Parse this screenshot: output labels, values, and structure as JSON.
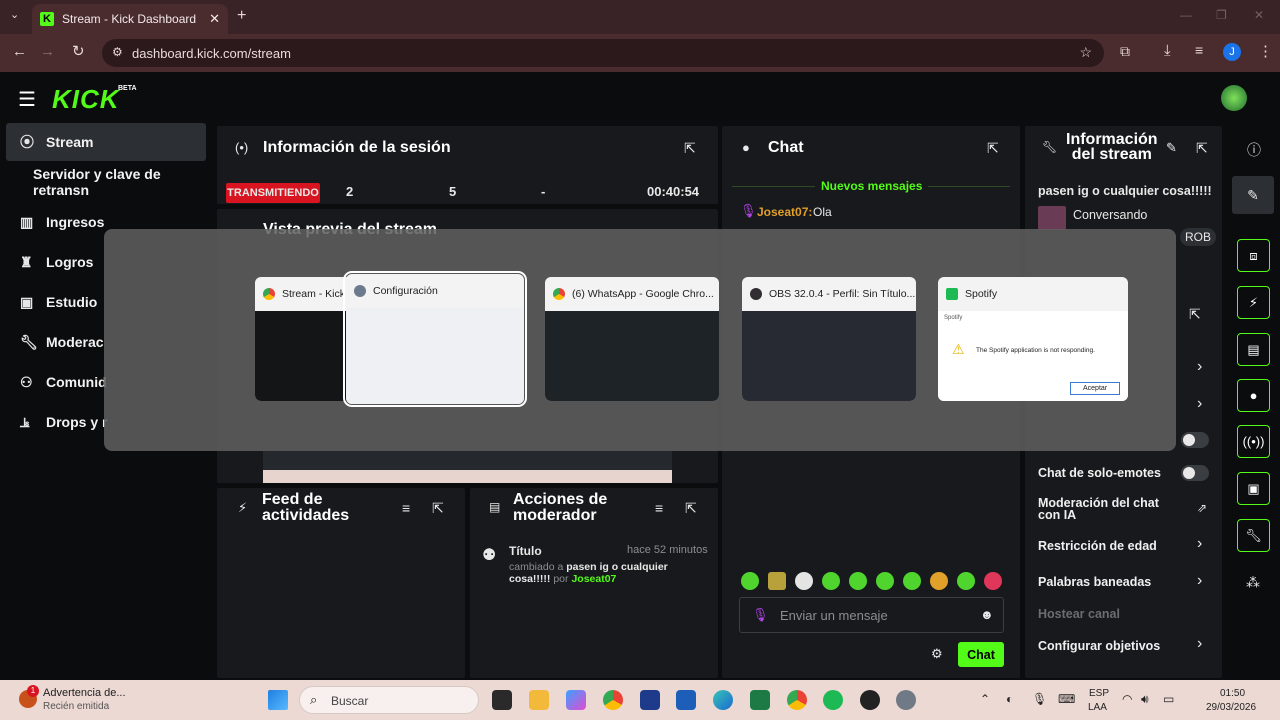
{
  "browser": {
    "tab_title": "Stream - Kick Dashboard",
    "url": "dashboard.kick.com/stream",
    "profile_initial": "J"
  },
  "app": {
    "logo": "KICK",
    "beta": "BETA"
  },
  "sidebar": {
    "items": [
      "Stream",
      "Servidor y clave de retransn",
      "Ingresos",
      "Logros",
      "Estudio",
      "Moderac",
      "Comunid",
      "Drops y r"
    ]
  },
  "session": {
    "title": "Información de la sesión",
    "status": "TRANSMITIENDO",
    "viewers": "2",
    "followers": "5",
    "dash": "-",
    "time": "00:40:54"
  },
  "preview": {
    "title": "Vista previa del stream"
  },
  "chat": {
    "title": "Chat",
    "new_messages": "Nuevos mensajes",
    "msg_user": "Joseat07:",
    "msg_text": "Ola",
    "input_placeholder": "Enviar un mensaje",
    "send_label": "Chat"
  },
  "stream_info": {
    "title_line1": "Información",
    "title_line2": "del stream",
    "stream_title": "pasen ig o cualquier cosa!!!!!",
    "category": "Conversando",
    "tag": "ROB"
  },
  "settings": {
    "emote_only": "Chat de solo-emotes",
    "ai_moderation": "Moderación del chat con IA",
    "age_restriction": "Restricción de edad",
    "banned_words": "Palabras baneadas",
    "host": "Hostear canal",
    "goals": "Configurar objetivos"
  },
  "activity": {
    "title_line1": "Feed de",
    "title_line2": "actividades"
  },
  "modactions": {
    "title_line1": "Acciones de",
    "title_line2": "moderador",
    "item_title": "Título",
    "item_time": "hace 52 minutos",
    "item_prefix": "cambiado a",
    "item_value": "pasen ig o cualquier cosa!!!!!",
    "item_by": "por",
    "item_user": "Joseat07"
  },
  "switcher": {
    "windows": [
      {
        "title": "Stream - Kick Dashboard - G...",
        "icon": "chrome"
      },
      {
        "title": "Configuración",
        "icon": "settings"
      },
      {
        "title": "(6) WhatsApp - Google Chro...",
        "icon": "chrome"
      },
      {
        "title": "OBS 32.0.4 - Perfil: Sin Título...",
        "icon": "obs"
      },
      {
        "title": "Spotify",
        "icon": "spotify"
      }
    ],
    "spotify_dialog_title": "Spotify",
    "spotify_dialog_text": "The Spotify application is not responding.",
    "spotify_dialog_btn": "Aceptar"
  },
  "taskbar": {
    "notif_title": "Advertencia de...",
    "notif_sub": "Recién emitida",
    "notif_badge": "1",
    "search": "Buscar",
    "lang1": "ESP",
    "lang2": "LAA",
    "time": "01:50",
    "date": "29/03/2026"
  }
}
